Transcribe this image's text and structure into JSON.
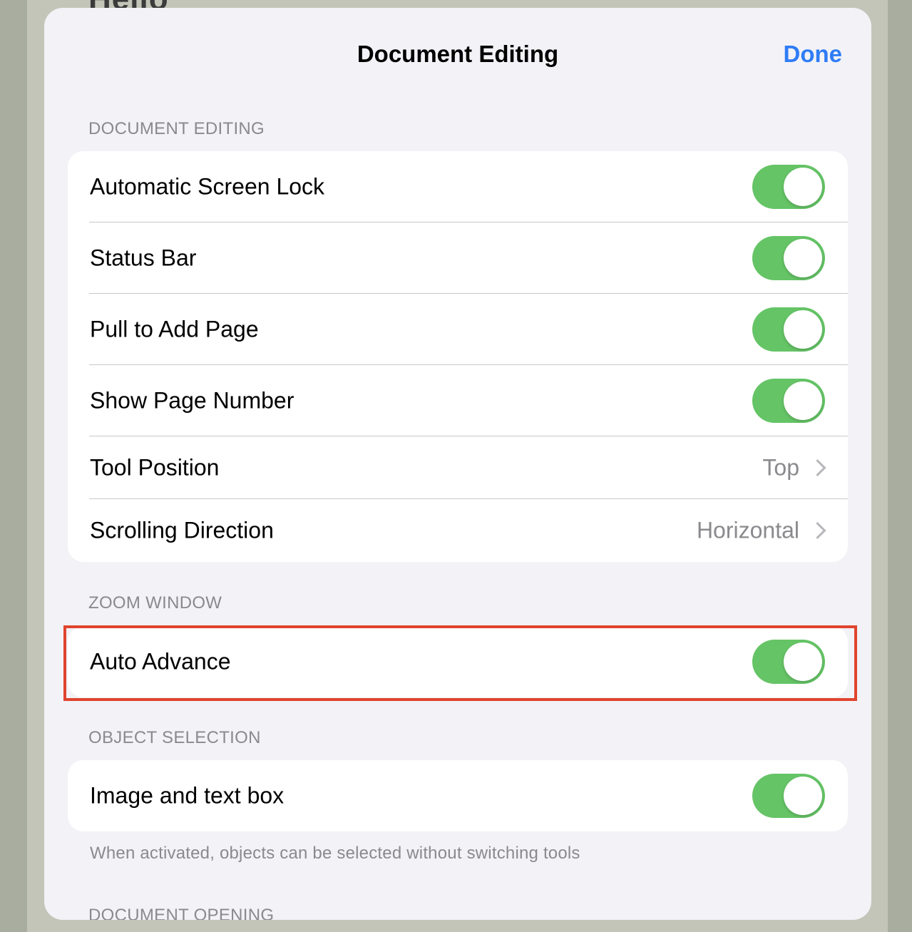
{
  "background": {
    "partial_text": "Hello"
  },
  "sheet": {
    "title": "Document Editing",
    "done_label": "Done",
    "accent_color": "#2f7cf6",
    "toggle_on_color": "#65c466"
  },
  "sections": {
    "document_editing": {
      "header": "DOCUMENT EDITING",
      "rows": [
        {
          "label": "Automatic Screen Lock",
          "toggle": true
        },
        {
          "label": "Status Bar",
          "toggle": true
        },
        {
          "label": "Pull to Add Page",
          "toggle": true
        },
        {
          "label": "Show Page Number",
          "toggle": true
        },
        {
          "label": "Tool Position",
          "value": "Top"
        },
        {
          "label": "Scrolling Direction",
          "value": "Horizontal"
        }
      ]
    },
    "zoom_window": {
      "header": "ZOOM WINDOW",
      "rows": [
        {
          "label": "Auto Advance",
          "toggle": true
        }
      ]
    },
    "object_selection": {
      "header": "OBJECT SELECTION",
      "rows": [
        {
          "label": "Image and text box",
          "toggle": true
        }
      ],
      "footer": "When activated, objects can be selected without switching tools"
    },
    "document_opening": {
      "header": "DOCUMENT OPENING"
    }
  },
  "annotation": {
    "highlight_color": "#e0442e",
    "highlighted_item": "Auto Advance"
  }
}
